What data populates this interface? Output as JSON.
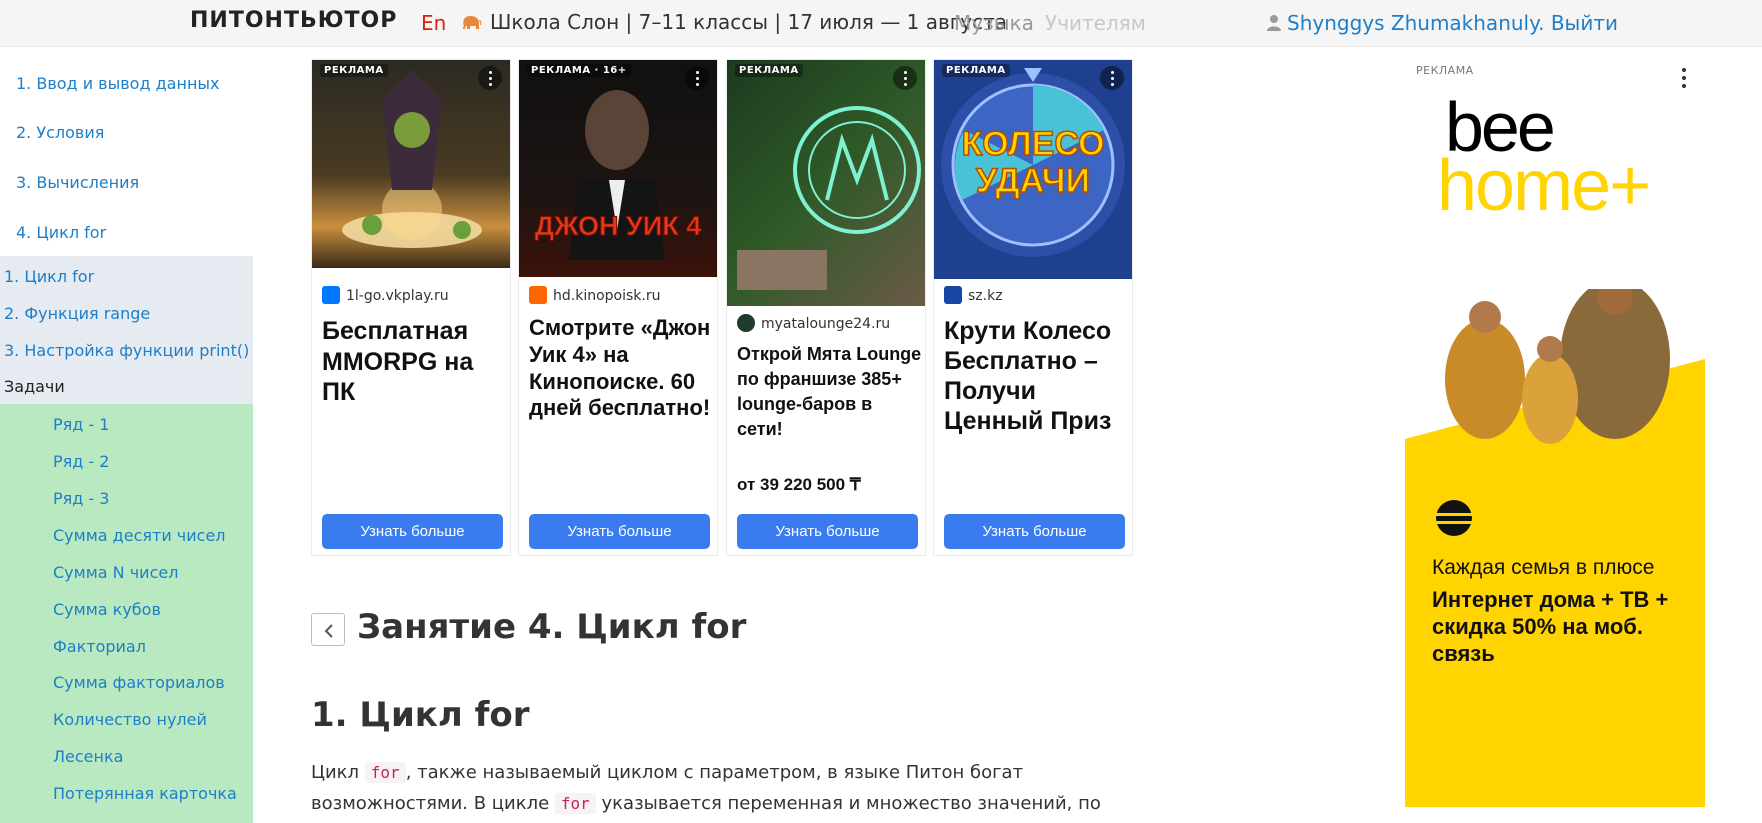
{
  "header": {
    "logo": "ПИТОНТЬЮТОР",
    "lang": "En",
    "school": "Школа Слон | 7–11 классы | 17 июля — 1 августа",
    "music": "Музыка",
    "teachers": "Учителям",
    "user_name": "Shynggys Zhumakhanuly.",
    "logout": "Выйти"
  },
  "sidebar": {
    "lessons": [
      "1. Ввод и вывод данных",
      "2. Условия",
      "3. Вычисления",
      "4. Цикл for"
    ],
    "sections": [
      "1. Цикл for",
      "2. Функция range",
      "3. Настройка функции print()"
    ],
    "tasks_label": "Задачи",
    "tasks": [
      "Ряд - 1",
      "Ряд - 2",
      "Ряд - 3",
      "Сумма десяти чисел",
      "Сумма N чисел",
      "Сумма кубов",
      "Факториал",
      "Сумма факториалов",
      "Количество нулей",
      "Лесенка",
      "Потерянная карточка"
    ]
  },
  "ads": [
    {
      "badge": "РЕКЛАМА",
      "domain": "1l-go.vkplay.ru",
      "headline": "Бесплатная MMORPG на ПК",
      "button": "Узнать больше",
      "fav_color": "#0077ff"
    },
    {
      "badge": "РЕКЛАМА · 16+",
      "domain": "hd.kinopoisk.ru",
      "headline": "Смотрите «Джон Уик 4» на Кинопоиске. 60 дней бесплатно!",
      "image_text": "ДЖОН УИК 4",
      "button": "Узнать больше",
      "fav_color": "#ff6600"
    },
    {
      "badge": "РЕКЛАМА",
      "domain": "myatalounge24.ru",
      "headline": "Открой Мята Lounge по франшизе 385+ lounge-баров в сети!",
      "price": "от 39 220 500 ₸",
      "button": "Узнать больше",
      "fav_color": "#1f3b2d"
    },
    {
      "badge": "РЕКЛАМА",
      "domain": "sz.kz",
      "headline": "Крути Колесо Бесплатно – Получи Ценный Приз",
      "image_text": "КОЛЕСО УДАЧИ",
      "button": "Узнать больше",
      "fav_color": "#1747a6"
    }
  ],
  "right_ad": {
    "label": "РЕКЛАМА",
    "brand_top": "bee",
    "brand_bottom": "home+",
    "tagline": "Каждая семья в плюсе",
    "offer": "Интернет дома + ТВ + скидка 50% на моб. связь"
  },
  "content": {
    "lesson_title": "Занятие 4. Цикл for",
    "section_title": "1. Цикл for",
    "para_1": "Цикл ",
    "code_1": "for",
    "para_2": ", также называемый циклом с параметром, в языке Питон богат возможностями. В цикле ",
    "code_2": "for",
    "para_3": " указывается переменная и множество значений, по"
  },
  "colors": {
    "link": "#1e7ec8",
    "lang": "#d9230f",
    "sidebar_active": "#e6ebf2",
    "sidebar_tasks": "#b9e9c0",
    "ad_button": "#3a7cf0",
    "beeline_yellow": "#ffd400"
  }
}
